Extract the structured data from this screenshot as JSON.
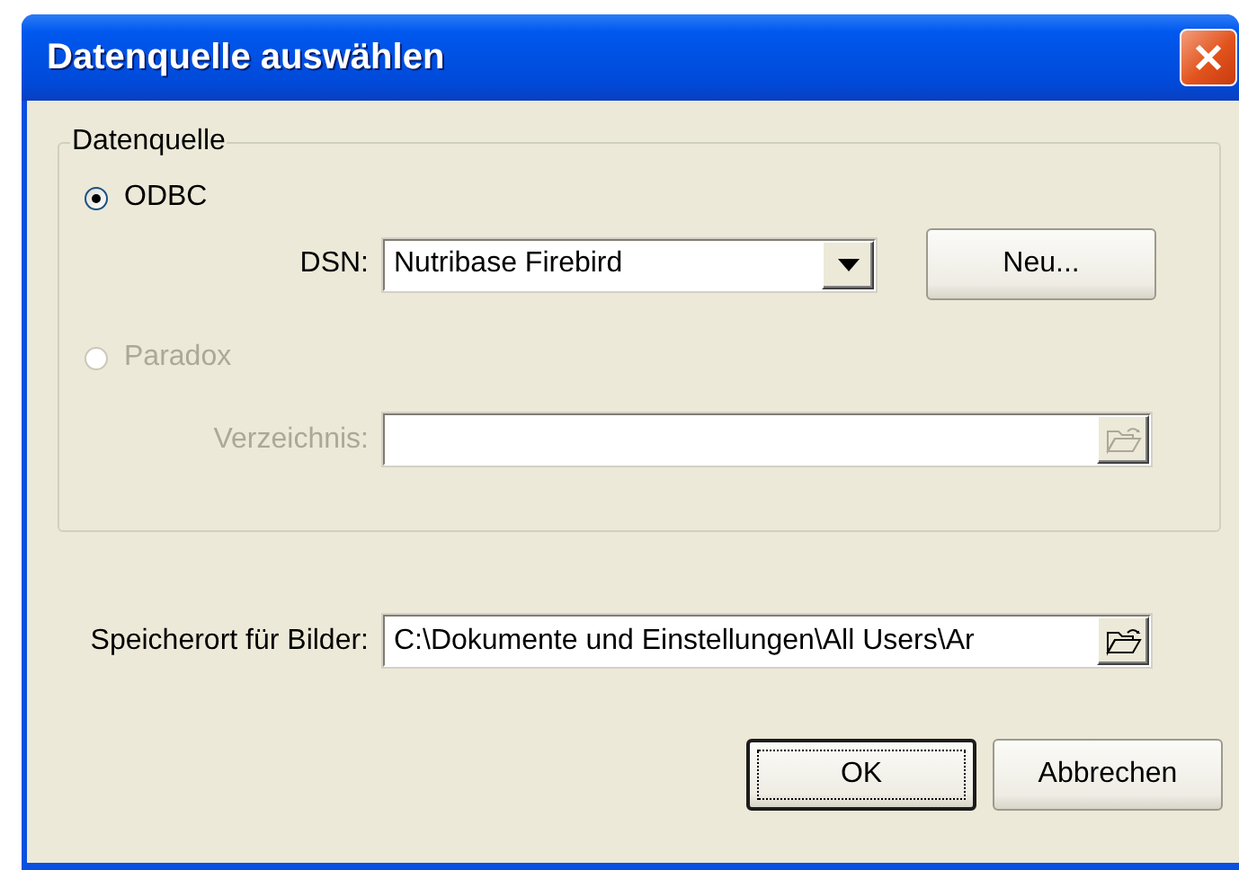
{
  "window": {
    "title": "Datenquelle auswählen"
  },
  "group": {
    "title": "Datenquelle"
  },
  "sources": [
    {
      "label": "ODBC",
      "selected": true,
      "disabled": false,
      "field": {
        "kind": "combo",
        "label": "DSN:",
        "value": "Nutribase Firebird",
        "button": {
          "label": "Neu..."
        }
      }
    },
    {
      "label": "Paradox",
      "selected": false,
      "disabled": true,
      "field": {
        "kind": "path",
        "label": "Verzeichnis:"
      }
    }
  ],
  "image_location": {
    "label": "Speicherort für Bilder:",
    "value": "C:\\Dokumente und Einstellungen\\All Users\\Ar"
  },
  "buttons": [
    {
      "label": "OK",
      "default": true
    },
    {
      "label": "Abbrechen",
      "default": false
    }
  ]
}
